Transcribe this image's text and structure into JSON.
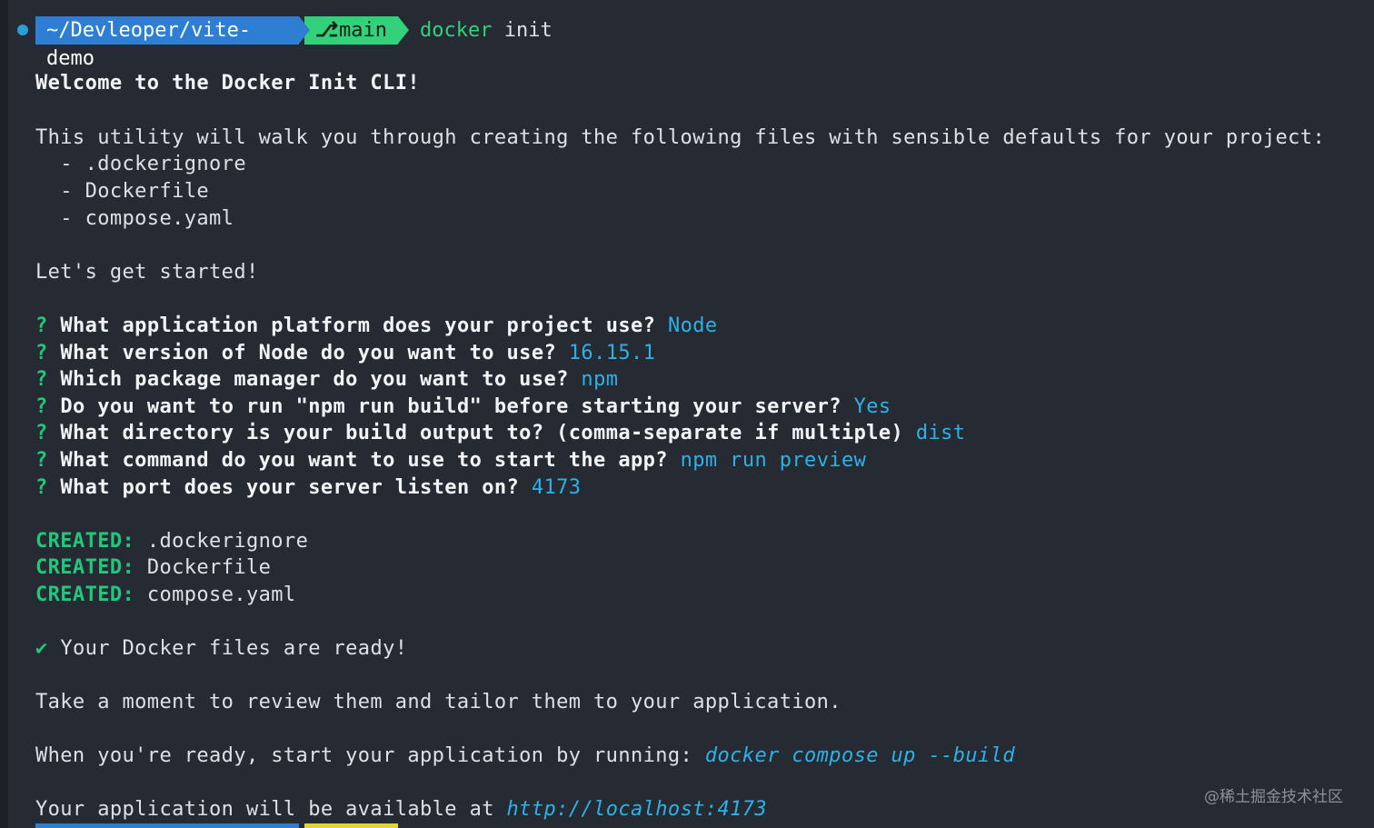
{
  "prompt": {
    "path": "~/Devleoper/vite-demo",
    "branch_icon": "git-branch-icon",
    "branch": "main",
    "command_name": "docker",
    "command_args": "init"
  },
  "output": {
    "welcome": "Welcome to the Docker Init CLI!",
    "intro": "This utility will walk you through creating the following files with sensible defaults for your project:",
    "files_list": [
      "  - .dockerignore",
      "  - Dockerfile",
      "  - compose.yaml"
    ],
    "lets_start": "Let's get started!",
    "questions": [
      {
        "mark": "?",
        "q": "What application platform does your project use?",
        "a": "Node"
      },
      {
        "mark": "?",
        "q": "What version of Node do you want to use?",
        "a": "16.15.1"
      },
      {
        "mark": "?",
        "q": "Which package manager do you want to use?",
        "a": "npm"
      },
      {
        "mark": "?",
        "q": "Do you want to run \"npm run build\" before starting your server?",
        "a": "Yes"
      },
      {
        "mark": "?",
        "q": "What directory is your build output to? (comma-separate if multiple)",
        "a": "dist"
      },
      {
        "mark": "?",
        "q": "What command do you want to use to start the app?",
        "a": "npm run preview"
      },
      {
        "mark": "?",
        "q": "What port does your server listen on?",
        "a": "4173"
      }
    ],
    "created": [
      {
        "label": "CREATED:",
        "file": ".dockerignore"
      },
      {
        "label": "CREATED:",
        "file": "Dockerfile"
      },
      {
        "label": "CREATED:",
        "file": "compose.yaml"
      }
    ],
    "ready_mark": "✔",
    "ready": "Your Docker files are ready!",
    "review": "Take a moment to review them and tailor them to your application.",
    "run_prefix": "When you're ready, start your application by running:",
    "run_cmd": "docker compose up --build",
    "available_prefix": "Your application will be available at",
    "available_url": "http://localhost:4173"
  },
  "watermark": "@稀土掘金技术社区",
  "colors": {
    "background": "#262a32",
    "path_segment": "#2e7fd3",
    "branch_segment": "#33d17a",
    "answer": "#2db1e6",
    "created": "#22c77c"
  }
}
